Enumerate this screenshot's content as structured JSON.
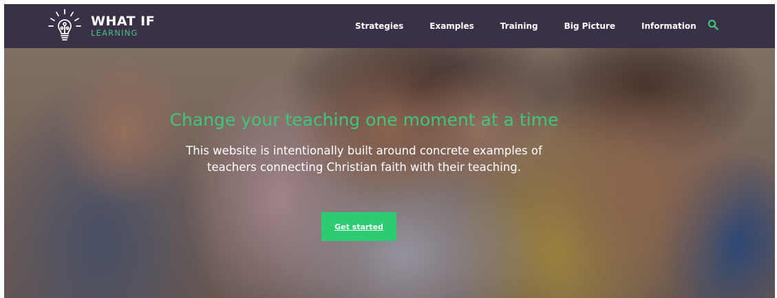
{
  "header": {
    "logo": {
      "line1": "WHAT IF",
      "line2": "LEARNING",
      "icon": "lightbulb-icon"
    },
    "nav": [
      {
        "label": "Strategies"
      },
      {
        "label": "Examples"
      },
      {
        "label": "Training"
      },
      {
        "label": "Big Picture"
      },
      {
        "label": "Information"
      }
    ],
    "search_icon": "search-icon"
  },
  "hero": {
    "title": "Change your teaching one moment at a time",
    "subtitle_line1": "This website is intentionally built around concrete examples of",
    "subtitle_line2": "teachers connecting Christian faith with their teaching.",
    "cta_label": "Get started",
    "image": "photo of a teacher with children gathered around a table"
  },
  "colors": {
    "header_bg": "#3a3047",
    "accent_green": "#3ec77c",
    "button_green": "#2ecc71",
    "text_white": "#ffffff"
  }
}
